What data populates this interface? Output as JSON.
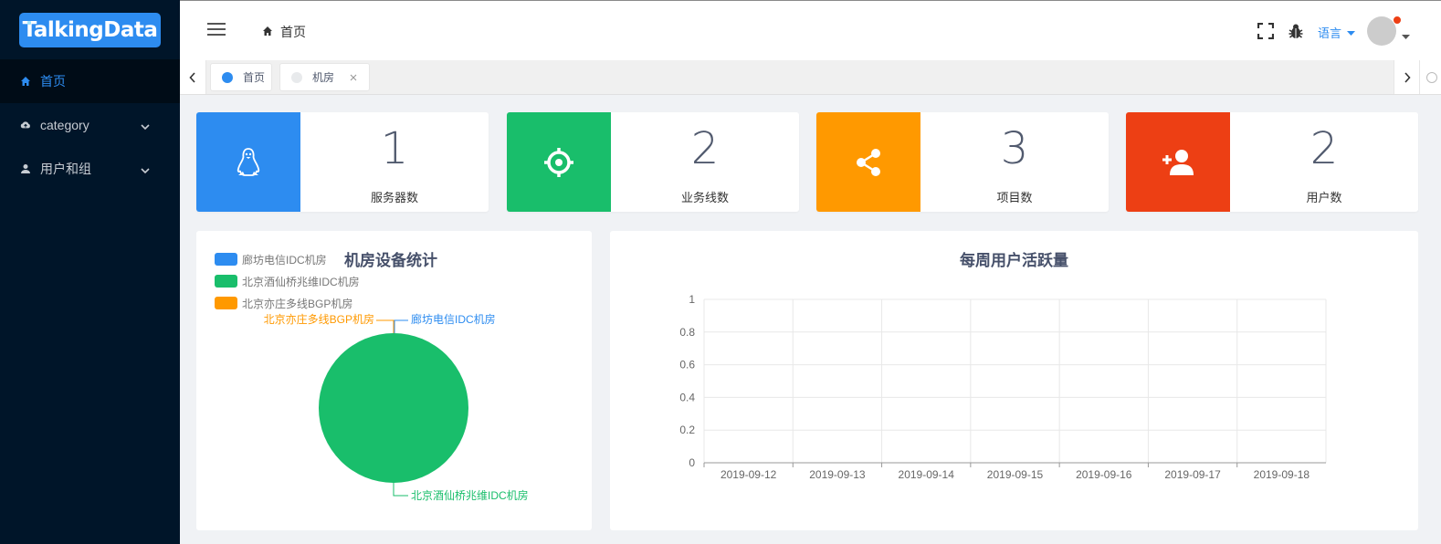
{
  "app": {
    "logo_text": "TalkingData"
  },
  "sidebar": {
    "items": [
      {
        "label": "首页",
        "icon": "home-icon",
        "active": true
      },
      {
        "label": "category",
        "icon": "cloud-icon"
      },
      {
        "label": "用户和组",
        "icon": "user-icon"
      }
    ]
  },
  "header": {
    "breadcrumb": "首页",
    "language": "语言"
  },
  "tabs": [
    {
      "label": "首页",
      "active": true
    },
    {
      "label": "机房",
      "active": false
    }
  ],
  "stats": [
    {
      "value": "1",
      "label": "服务器数",
      "color": "#2d8cf0",
      "icon": "linux-penguin-icon"
    },
    {
      "value": "2",
      "label": "业务线数",
      "color": "#19be6b",
      "icon": "target-icon"
    },
    {
      "value": "3",
      "label": "项目数",
      "color": "#ff9900",
      "icon": "share-icon"
    },
    {
      "value": "2",
      "label": "用户数",
      "color": "#ed3f14",
      "icon": "add-user-icon"
    }
  ],
  "chart_data": [
    {
      "type": "pie",
      "title": "机房设备统计",
      "legend": "top-left",
      "categories": [
        "廊坊电信IDC机房",
        "北京酒仙桥兆维IDC机房",
        "北京亦庄多线BGP机房"
      ],
      "values": [
        0,
        1,
        0
      ],
      "colors": [
        "#2d8cf0",
        "#19be6b",
        "#ff9900"
      ]
    },
    {
      "type": "line",
      "title": "每周用户活跃量",
      "x": [
        "2019-09-12",
        "2019-09-13",
        "2019-09-14",
        "2019-09-15",
        "2019-09-16",
        "2019-09-17",
        "2019-09-18"
      ],
      "yticks": [
        "0",
        "0.2",
        "0.4",
        "0.6",
        "0.8",
        "1"
      ],
      "ylim": [
        0,
        1
      ],
      "grid": true,
      "series": []
    }
  ]
}
